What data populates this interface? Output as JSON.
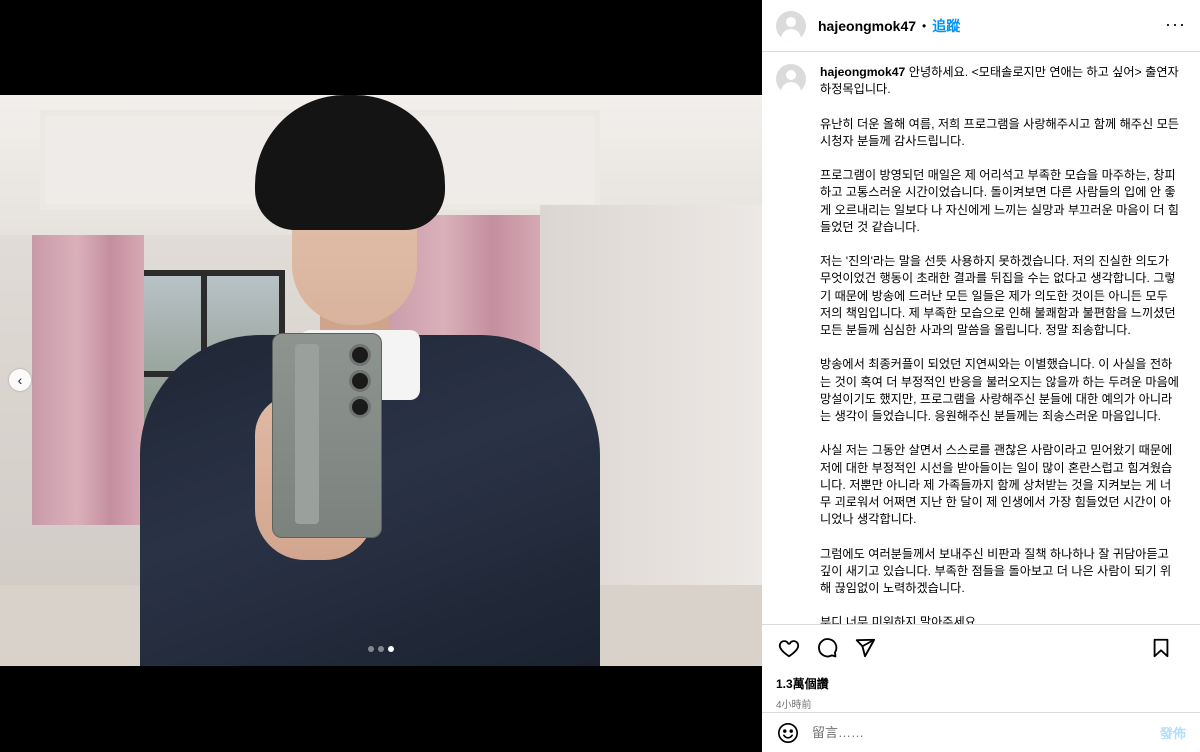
{
  "post": {
    "username": "hajeongmok47",
    "follow_label": "追蹤",
    "more_label": "···",
    "caption_paragraphs": [
      "안녕하세요. <모태솔로지만 연애는 하고 싶어> 출연자 하정목입니다.",
      "유난히 더운 올해 여름, 저희 프로그램을 사랑해주시고 함께 해주신 모든 시청자 분들께 감사드립니다.",
      "프로그램이 방영되던 매일은 제 어리석고 부족한 모습을 마주하는, 창피하고 고통스러운 시간이었습니다. 돌이켜보면 다른 사람들의 입에 안 좋게 오르내리는 일보다 나 자신에게 느끼는 실망과 부끄러운 마음이 더 힘들었던 것 같습니다.",
      "저는 '진의'라는 말을 선뜻 사용하지 못하겠습니다. 저의 진실한 의도가 무엇이었건 행동이 초래한 결과를 뒤집을 수는 없다고 생각합니다. 그렇기 때문에 방송에 드러난 모든 일들은 제가 의도한 것이든 아니든 모두 저의 책임입니다. 제 부족한 모습으로 인해 불쾌함과 불편함을 느끼셨던 모든 분들께 심심한 사과의 말씀을 올립니다. 정말 죄송합니다.",
      "방송에서 최종커플이 되었던 지연씨와는 이별했습니다. 이 사실을 전하는 것이 혹여 더 부정적인 반응을 불러오지는 않을까 하는 두려운 마음에 망설이기도 했지만, 프로그램을 사랑해주신 분들에 대한 예의가 아니라는 생각이 들었습니다. 응원해주신 분들께는 죄송스러운 마음입니다.",
      "사실 저는 그동안 살면서 스스로를 괜찮은 사람이라고 믿어왔기 때문에 저에 대한 부정적인 시선을 받아들이는 일이 많이 혼란스럽고 힘겨웠습니다. 저뿐만 아니라 제 가족들까지 함께 상처받는 것을 지켜보는 게 너무 괴로워서 어쩌면 지난 한 달이 제 인생에서 가장 힘들었던 시간이 아니었나 생각합니다.",
      "그럼에도 여러분들께서 보내주신 비판과 질책 하나하나 잘 귀담아듣고 깊이 새기고 있습니다. 부족한 점들을 돌아보고 더 나은 사람이 되기 위해 끊임없이 노력하겠습니다.",
      "부디 너무 미워하지 말아주세요."
    ],
    "likes_label": "1.3萬個讚",
    "time_label": "4小時前",
    "comment_placeholder": "留言……",
    "post_button_label": "發佈",
    "carousel": {
      "total": 3,
      "active_index": 2
    }
  },
  "icons": {
    "like": "heart-icon",
    "comment": "comment-icon",
    "share": "share-icon",
    "save": "bookmark-icon",
    "emoji": "emoji-icon",
    "prev": "chevron-left-icon"
  },
  "colors": {
    "accent": "#0095f6",
    "post_disabled": "#b2dffc",
    "border": "#dbdbdb",
    "secondary_text": "#737373"
  }
}
